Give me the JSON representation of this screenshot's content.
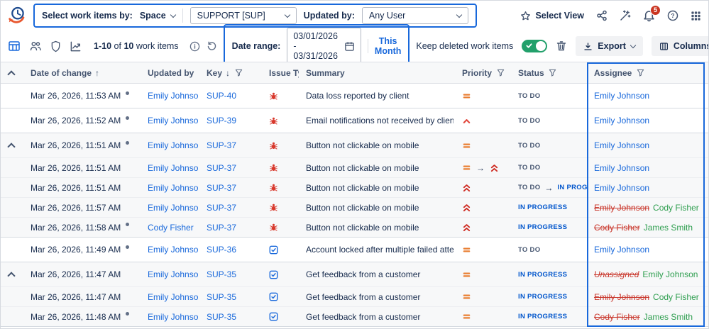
{
  "topbar": {
    "select_by_label": "Select work items by:",
    "space_value": "Space",
    "project_value": "SUPPORT [SUP]",
    "updated_by_label": "Updated by:",
    "updated_by_value": "Any User",
    "select_view": "Select View",
    "notification_count": "5"
  },
  "toolbar": {
    "count_range": "1-10",
    "count_of": "of",
    "count_total": "10",
    "count_suffix": "work items",
    "date_range_label": "Date range:",
    "date_range_value": "03/01/2026 - 03/31/2026",
    "this_month": "This Month",
    "keep_deleted": "Keep deleted work items",
    "export_label": "Export",
    "columns_label": "Columns"
  },
  "icons": {
    "star": "select-view star",
    "share": "share nodes",
    "wand": "magic wand",
    "bell": "notifications",
    "help": "?",
    "apps": "apps grid",
    "table_view": "table view",
    "people": "users",
    "shield": "shield",
    "chart": "chart",
    "info": "info",
    "refresh": "refresh",
    "calendar": "calendar",
    "trash": "delete",
    "download": "export download",
    "columns": "columns"
  },
  "colors": {
    "accent": "#1868DB",
    "link": "#1868DB",
    "removed_value": "#C9372C",
    "added_value": "#2E9E4F",
    "priority_medium": "#E97F33",
    "priority_high": "#E2483D",
    "priority_highest": "#CE2A21",
    "status_todo": "#44546F",
    "status_in_progress": "#0055CC",
    "toggle_on": "#22A06B",
    "badge": "#CA3521"
  },
  "table": {
    "columns": [
      "Date of change",
      "Updated by",
      "Key",
      "Issue Type",
      "Summary",
      "Priority",
      "Status",
      "Assignee"
    ],
    "rows": [
      {
        "date": "Mar 26, 2026, 11:53 AM",
        "dot": true,
        "group_start": false,
        "group_end": true,
        "shaded": false,
        "tall": true,
        "updated_by": "Emily Johnson",
        "key": "SUP-40",
        "issue_type": "bug",
        "summary": "Data loss reported by client",
        "priority": [
          "medium"
        ],
        "status": [
          "TO DO"
        ],
        "assignee": {
          "current": "Emily Johnson"
        }
      },
      {
        "date": "Mar 26, 2026, 11:52 AM",
        "dot": true,
        "group_start": false,
        "group_end": true,
        "shaded": false,
        "tall": true,
        "updated_by": "Emily Johnson",
        "key": "SUP-39",
        "issue_type": "bug",
        "summary": "Email notifications not received by client",
        "priority": [
          "high"
        ],
        "status": [
          "TO DO"
        ],
        "assignee": {
          "current": "Emily Johnson"
        }
      },
      {
        "date": "Mar 26, 2026, 11:51 AM",
        "dot": true,
        "group_start": true,
        "group_end": false,
        "shaded": true,
        "tall": true,
        "updated_by": "Emily Johnson",
        "key": "SUP-37",
        "issue_type": "bug",
        "summary": "Button not clickable on mobile",
        "priority": [
          "medium"
        ],
        "status": [
          "TO DO"
        ],
        "assignee": {
          "current": "Emily Johnson"
        }
      },
      {
        "date": "Mar 26, 2026, 11:51 AM",
        "dot": false,
        "group_start": false,
        "group_end": false,
        "shaded": true,
        "tall": false,
        "updated_by": "Emily Johnson",
        "key": "SUP-37",
        "issue_type": "bug",
        "summary": "Button not clickable on mobile",
        "priority": [
          "medium",
          "highest"
        ],
        "status": [
          "TO DO"
        ],
        "assignee": {
          "current": "Emily Johnson"
        }
      },
      {
        "date": "Mar 26, 2026, 11:51 AM",
        "dot": false,
        "group_start": false,
        "group_end": false,
        "shaded": true,
        "tall": false,
        "updated_by": "Emily Johnson",
        "key": "SUP-37",
        "issue_type": "bug",
        "summary": "Button not clickable on mobile",
        "priority": [
          "highest"
        ],
        "status": [
          "TO DO",
          "IN PROGRESS"
        ],
        "assignee": {
          "current": "Emily Johnson"
        }
      },
      {
        "date": "Mar 26, 2026, 11:57 AM",
        "dot": false,
        "group_start": false,
        "group_end": false,
        "shaded": true,
        "tall": false,
        "updated_by": "Emily Johnson",
        "key": "SUP-37",
        "issue_type": "bug",
        "summary": "Button not clickable on mobile",
        "priority": [
          "highest"
        ],
        "status": [
          "IN PROGRESS"
        ],
        "assignee": {
          "old": "Emily Johnson",
          "new": "Cody Fisher"
        }
      },
      {
        "date": "Mar 26, 2026, 11:58 AM",
        "dot": true,
        "group_start": false,
        "group_end": true,
        "shaded": true,
        "tall": false,
        "updated_by": "Cody Fisher",
        "key": "SUP-37",
        "issue_type": "bug",
        "summary": "Button not clickable on mobile",
        "priority": [
          "highest"
        ],
        "status": [
          "IN PROGRESS"
        ],
        "assignee": {
          "old": "Cody Fisher",
          "new": "James Smith"
        }
      },
      {
        "date": "Mar 26, 2026, 11:49 AM",
        "dot": true,
        "group_start": false,
        "group_end": true,
        "shaded": false,
        "tall": true,
        "updated_by": "Emily Johnson",
        "key": "SUP-36",
        "issue_type": "task",
        "summary": "Account locked after multiple failed attempts",
        "priority": [
          "medium"
        ],
        "status": [
          "TO DO"
        ],
        "assignee": {
          "current": "Emily Johnson"
        }
      },
      {
        "date": "Mar 26, 2026, 11:47 AM",
        "dot": false,
        "group_start": true,
        "group_end": false,
        "shaded": true,
        "tall": true,
        "updated_by": "Emily Johnson",
        "key": "SUP-35",
        "issue_type": "task",
        "summary": "Get feedback from a customer",
        "priority": [
          "medium"
        ],
        "status": [
          "IN PROGRESS"
        ],
        "assignee": {
          "old": "Unassigned",
          "new": "Emily Johnson",
          "old_italic": true
        }
      },
      {
        "date": "Mar 26, 2026, 11:47 AM",
        "dot": false,
        "group_start": false,
        "group_end": false,
        "shaded": true,
        "tall": false,
        "updated_by": "Emily Johnson",
        "key": "SUP-35",
        "issue_type": "task",
        "summary": "Get feedback from a customer",
        "priority": [
          "medium"
        ],
        "status": [
          "IN PROGRESS"
        ],
        "assignee": {
          "old": "Emily Johnson",
          "new": "Cody Fisher"
        }
      },
      {
        "date": "Mar 26, 2026, 11:48 AM",
        "dot": true,
        "group_start": false,
        "group_end": true,
        "shaded": true,
        "tall": false,
        "updated_by": "Emily Johnson",
        "key": "SUP-35",
        "issue_type": "task",
        "summary": "Get feedback from a customer",
        "priority": [
          "medium"
        ],
        "status": [
          "IN PROGRESS"
        ],
        "assignee": {
          "old": "Cody Fisher",
          "new": "James Smith"
        }
      }
    ]
  }
}
